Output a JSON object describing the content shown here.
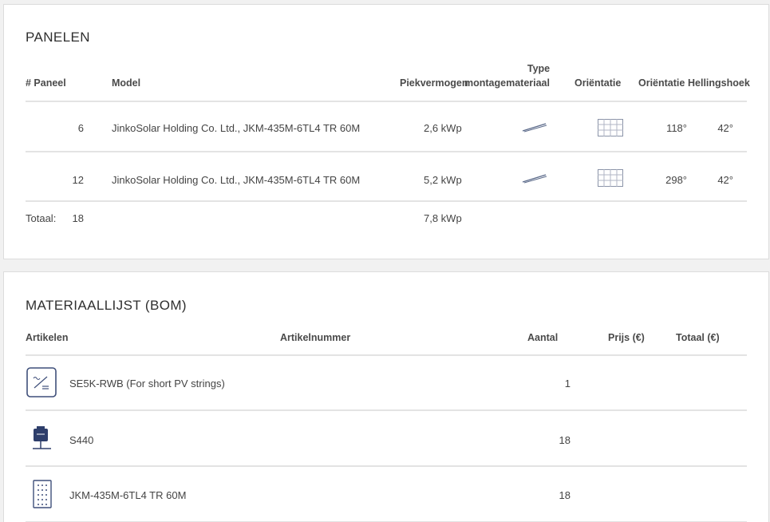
{
  "panelen": {
    "title": "PANELEN",
    "headers": {
      "paneel": "# Paneel",
      "model": "Model",
      "piekvermogen": "Piekvermogen",
      "montage_top": "Type",
      "montage_bottom": "montagemateriaal",
      "orientatie": "Oriëntatie",
      "orientatie2": "Oriëntatie",
      "hellingshoek": "Hellingshoek"
    },
    "rows": [
      {
        "count": "6",
        "model": "JinkoSolar Holding Co. Ltd., JKM-435M-6TL4 TR 60M",
        "power": "2,6 kWp",
        "montage_icon": "roof-mount-icon",
        "orientation_icon": "panel-grid-icon",
        "azimuth": "118°",
        "tilt": "42°"
      },
      {
        "count": "12",
        "model": "JinkoSolar Holding Co. Ltd., JKM-435M-6TL4 TR 60M",
        "power": "5,2 kWp",
        "montage_icon": "roof-mount-icon",
        "orientation_icon": "panel-grid-icon",
        "azimuth": "298°",
        "tilt": "42°"
      }
    ],
    "total": {
      "label": "Totaal:",
      "count": "18",
      "power": "7,8 kWp"
    }
  },
  "bom": {
    "title": "MATERIAALLIJST (BOM)",
    "headers": {
      "artikelen": "Artikelen",
      "artikelnummer": "Artikelnummer",
      "aantal": "Aantal",
      "prijs": "Prijs (€)",
      "totaal": "Totaal (€)"
    },
    "rows": [
      {
        "icon": "inverter-icon",
        "name": "SE5K-RWB (For short PV strings)",
        "qty": "1"
      },
      {
        "icon": "optimizer-icon",
        "name": "S440",
        "qty": "18"
      },
      {
        "icon": "solar-panel-icon",
        "name": "JKM-435M-6TL4 TR 60M",
        "qty": "18"
      }
    ]
  }
}
